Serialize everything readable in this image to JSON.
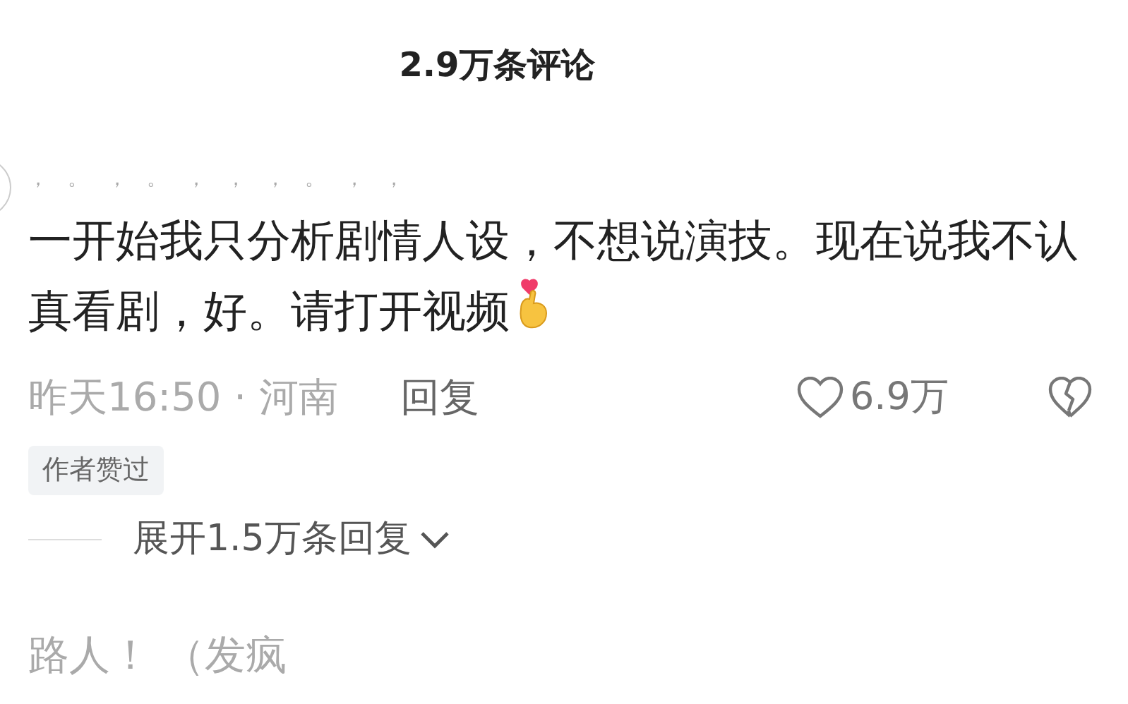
{
  "header": {
    "title": "2.9万条评论"
  },
  "comments": [
    {
      "username": "，。，。，，，。，，",
      "text": "一开始我只分析剧情人设，不想说演技。现在说我不认真看剧，好。请打开视频",
      "time_location": "昨天16:50 · 河南",
      "reply_label": "回复",
      "likes": "6.9万",
      "liked": false,
      "badge": "作者赞过",
      "expand_replies": "展开1.5万条回复"
    }
  ],
  "next_comment": {
    "text": "路人！ （发疯"
  }
}
